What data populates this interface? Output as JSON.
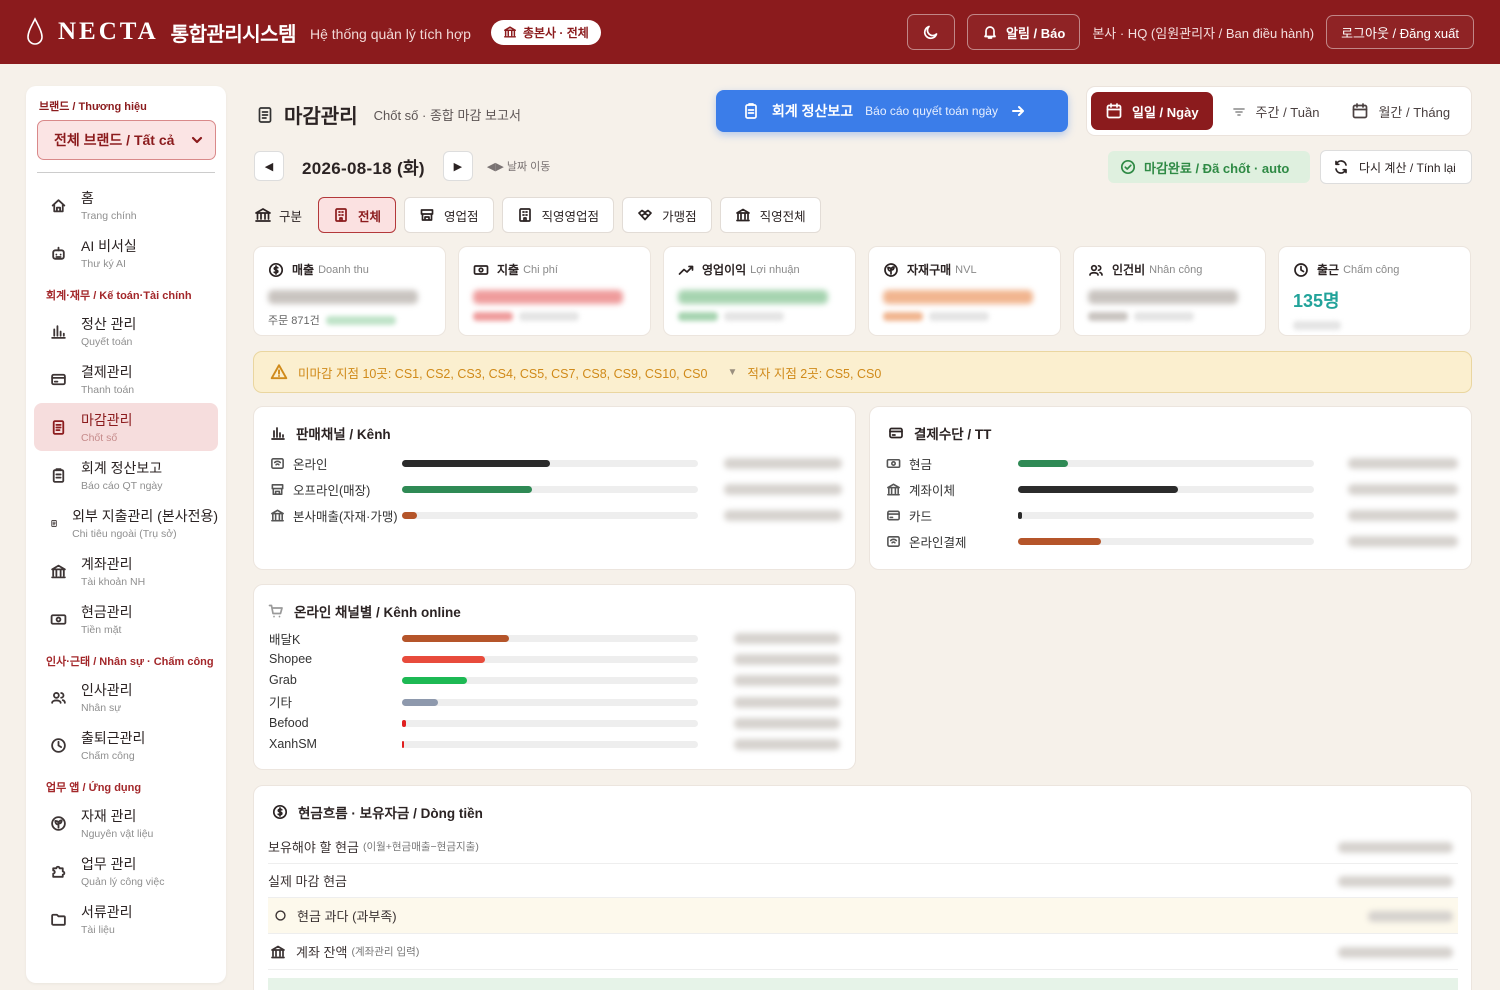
{
  "header": {
    "brand": "NECTA",
    "system": "통합관리시스템",
    "subtitle": "Hệ thống quản lý tích hợp",
    "scope_chip": "총본사 · 전체",
    "alert": "알림 / Báo",
    "user": "본사 · HQ (임원관리자 / Ban điều hành)",
    "logout": "로그아웃 / Đăng xuất"
  },
  "sidebar": {
    "brand_label": "브랜드 / Thương hiệu",
    "brand_value": "전체 브랜드 / Tất cả",
    "nav_top": [
      {
        "k": "홈",
        "v": "Trang chính",
        "icon": "home-icon"
      },
      {
        "k": "AI 비서실",
        "v": "Thư ký AI",
        "icon": "bot-icon"
      }
    ],
    "sec_fin": "회계·재무 / Kế toán·Tài chính",
    "nav_fin": [
      {
        "k": "정산 관리",
        "v": "Quyết toán",
        "icon": "chart-icon"
      },
      {
        "k": "결제관리",
        "v": "Thanh toán",
        "icon": "card-icon"
      },
      {
        "k": "마감관리",
        "v": "Chốt số",
        "icon": "doc-icon"
      },
      {
        "k": "회계 정산보고",
        "v": "Báo cáo QT ngày",
        "icon": "clipboard-icon"
      },
      {
        "k": "외부 지출관리 (본사전용)",
        "v": "Chi tiêu ngoài (Trụ sở)",
        "icon": "doc-icon"
      },
      {
        "k": "계좌관리",
        "v": "Tài khoản NH",
        "icon": "bank-icon"
      },
      {
        "k": "현금관리",
        "v": "Tiền mặt",
        "icon": "cash-icon"
      }
    ],
    "sec_hr": "인사·근태 / Nhân sự · Chấm công",
    "nav_hr": [
      {
        "k": "인사관리",
        "v": "Nhân sự",
        "icon": "users-icon"
      },
      {
        "k": "출퇴근관리",
        "v": "Chấm công",
        "icon": "clock-icon"
      }
    ],
    "sec_app": "업무 앱 / Ứng dụng",
    "nav_app": [
      {
        "k": "자재 관리",
        "v": "Nguyên vật liệu",
        "icon": "sprout-icon"
      },
      {
        "k": "업무 관리",
        "v": "Quản lý công việc",
        "icon": "puzzle-icon"
      },
      {
        "k": "서류관리",
        "v": "Tài liệu",
        "icon": "folder-icon"
      }
    ]
  },
  "page": {
    "title": "마감관리",
    "subtitle": "Chốt số · 종합 마감 보고서",
    "report_btn": "회계 정산보고",
    "report_btn_sub": "Báo cáo quyết toán ngày",
    "periods": [
      "일일 / Ngày",
      "주간 / Tuần",
      "월간 / Tháng"
    ],
    "date": "2026-08-18 (화)",
    "date_nav": "◀▶ 날짜 이동",
    "closed": "마감완료 / Đã chốt · auto",
    "recalc": "다시 계산 / Tính lại",
    "tab_label": "구분",
    "tabs": [
      "전체",
      "영업점",
      "직영영업점",
      "가맹점",
      "직영전체"
    ]
  },
  "kpis": [
    {
      "k": "매출",
      "v": "Doanh thu",
      "sub": "주문 871건",
      "color": "#c9c4c0"
    },
    {
      "k": "지출",
      "v": "Chi phí",
      "color": "#ef9c9c"
    },
    {
      "k": "영업이익",
      "v": "Lợi nhuận",
      "color": "#a6d4b0"
    },
    {
      "k": "자재구매",
      "v": "NVL",
      "color": "#f1b58f"
    },
    {
      "k": "인건비",
      "v": "Nhân công",
      "color": "#c9c4c0"
    },
    {
      "k": "출근",
      "v": "Chấm công",
      "value": "135명"
    }
  ],
  "warning": {
    "unclosed": "미마감 지점 10곳: CS1, CS2, CS3, CS4, CS5, CS7, CS8, CS9, CS10, CS0",
    "deficit": "적자 지점 2곳: CS5, CS0"
  },
  "channels": {
    "title": "판매채널 / Kênh",
    "rows": [
      {
        "label": "온라인",
        "pct": 0.5,
        "color": "#2b2b2b"
      },
      {
        "label": "오프라인(매장)",
        "pct": 0.44,
        "color": "#2f8a55"
      },
      {
        "label": "본사매출(자재·가맹)",
        "pct": 0.05,
        "color": "#b5552a"
      }
    ]
  },
  "payments": {
    "title": "결제수단 / TT",
    "rows": [
      {
        "label": "현금",
        "pct": 0.17,
        "color": "#2f8a55"
      },
      {
        "label": "계좌이체",
        "pct": 0.54,
        "color": "#2b2b2b"
      },
      {
        "label": "카드",
        "pct": 0.015,
        "color": "#2b2b2b"
      },
      {
        "label": "온라인결제",
        "pct": 0.28,
        "color": "#b5552a"
      }
    ]
  },
  "online": {
    "title": "온라인 채널별 / Kênh online",
    "rows": [
      {
        "label": "배달K",
        "pct": 0.36,
        "color": "#b5552a"
      },
      {
        "label": "Shopee",
        "pct": 0.28,
        "color": "#e84b3c"
      },
      {
        "label": "Grab",
        "pct": 0.22,
        "color": "#1db954"
      },
      {
        "label": "기타",
        "pct": 0.12,
        "color": "#8e99ad"
      },
      {
        "label": "Befood",
        "pct": 0.015,
        "color": "#e02020"
      },
      {
        "label": "XanhSM",
        "pct": 0.005,
        "color": "#e02020"
      }
    ]
  },
  "cashflow": {
    "title": "현금흐름 · 보유자금 / Dòng tiền",
    "rows": [
      {
        "k": "보유해야 할 현금",
        "s": "(이월+현금매출−현금지출)"
      },
      {
        "k": "실제 마감 현금",
        "s": ""
      },
      {
        "k": "현금 과다 (과부족)",
        "s": ""
      },
      {
        "k": "계좌 잔액",
        "s": "(계좌관리 입력)"
      }
    ]
  }
}
